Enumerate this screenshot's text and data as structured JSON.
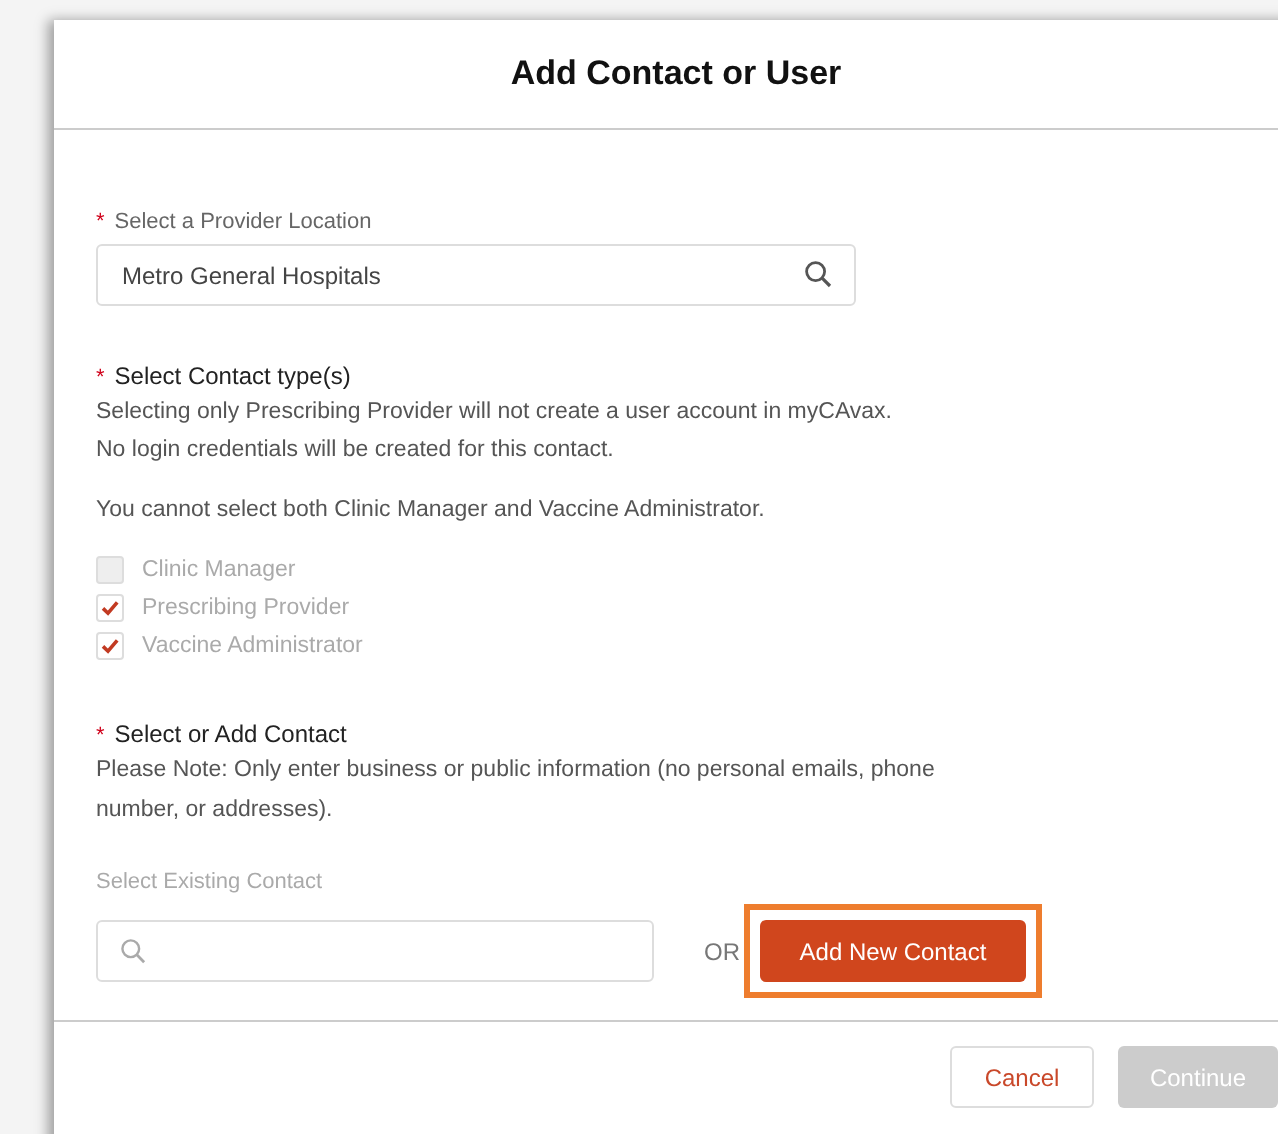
{
  "title": "Add Contact or User",
  "location": {
    "label": "Select a Provider Location",
    "required_mark": "*",
    "value": "Metro General Hospitals"
  },
  "contact_types": {
    "heading": "Select Contact type(s)",
    "required_mark": "*",
    "notes": [
      "Selecting only Prescribing Provider will not create a user account in myCAvax.",
      "No login credentials will be created for this contact."
    ],
    "warning": "You cannot select both Clinic Manager and Vaccine Administrator.",
    "options": [
      {
        "label": "Clinic Manager",
        "checked": false,
        "disabled": true
      },
      {
        "label": "Prescribing Provider",
        "checked": true,
        "disabled": false
      },
      {
        "label": "Vaccine Administrator",
        "checked": true,
        "disabled": false
      }
    ]
  },
  "contact": {
    "heading": "Select or Add Contact",
    "required_mark": "*",
    "note": "Please Note: Only enter business or public information (no personal emails, phone number, or addresses).",
    "search_label": "Select Existing Contact",
    "or": "OR",
    "add_button": "Add New Contact",
    "highlighted": true
  },
  "footer_buttons": [
    {
      "label": "Cancel",
      "kind": "secondary",
      "disabled": false
    },
    {
      "label": "Continue",
      "kind": "primary",
      "disabled": true
    }
  ]
}
